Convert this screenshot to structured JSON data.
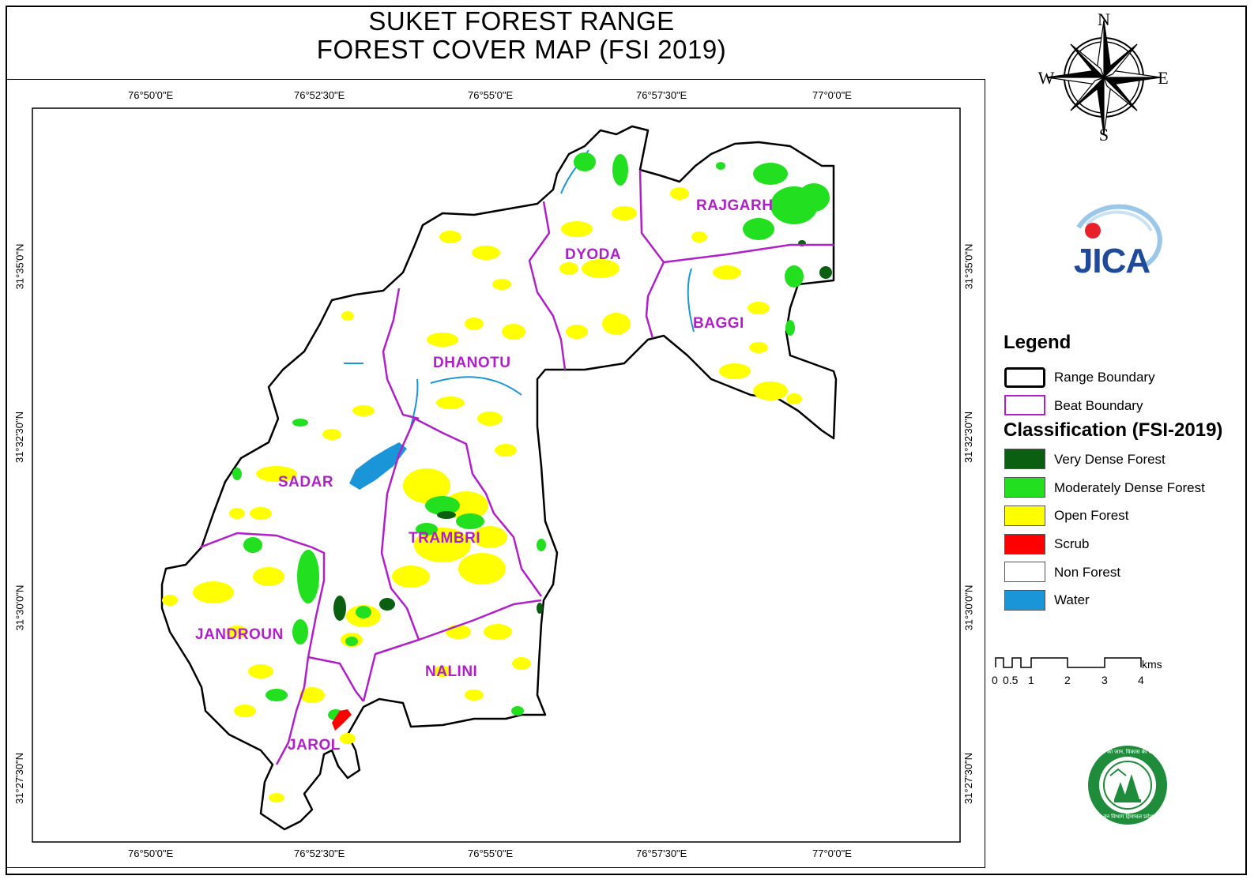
{
  "title": {
    "line1": "SUKET FOREST RANGE",
    "line2": "FOREST COVER MAP (FSI 2019)"
  },
  "compass": {
    "n": "N",
    "s": "S",
    "e": "E",
    "w": "W"
  },
  "logo": {
    "text": "JICA"
  },
  "emblem": {
    "top_text": "वन की जान, विकास की आन",
    "bottom_text": "वन विभाग हिमाचल प्रदेश"
  },
  "longitude_ticks": [
    "76°50'0\"E",
    "76°52'30\"E",
    "76°55'0\"E",
    "76°57'30\"E",
    "77°0'0\"E"
  ],
  "latitude_ticks": [
    "31°35'0\"N",
    "31°32'30\"N",
    "31°30'0\"N",
    "31°27'30\"N"
  ],
  "beats": [
    "RAJGARH",
    "DYODA",
    "BAGGI",
    "DHANOTU",
    "SADAR",
    "TRAMBRI",
    "JANDROUN",
    "NALINI",
    "JAROL"
  ],
  "legend": {
    "title": "Legend",
    "boundaries": [
      {
        "label": "Range Boundary",
        "color": "#000000"
      },
      {
        "label": "Beat Boundary",
        "color": "#b020c8"
      }
    ],
    "classification_title": "Classification (FSI-2019)",
    "classes": [
      {
        "label": "Very Dense Forest",
        "color": "#0a6010"
      },
      {
        "label": "Moderately Dense Forest",
        "color": "#22e020"
      },
      {
        "label": "Open Forest",
        "color": "#ffff00"
      },
      {
        "label": "Scrub",
        "color": "#ff0000"
      },
      {
        "label": "Non Forest",
        "color": "#ffffff"
      },
      {
        "label": "Water",
        "color": "#1a96d8"
      }
    ]
  },
  "scale_bar": {
    "unit": "kms",
    "ticks": [
      "0",
      "0.5",
      "1",
      "2",
      "3",
      "4"
    ]
  }
}
